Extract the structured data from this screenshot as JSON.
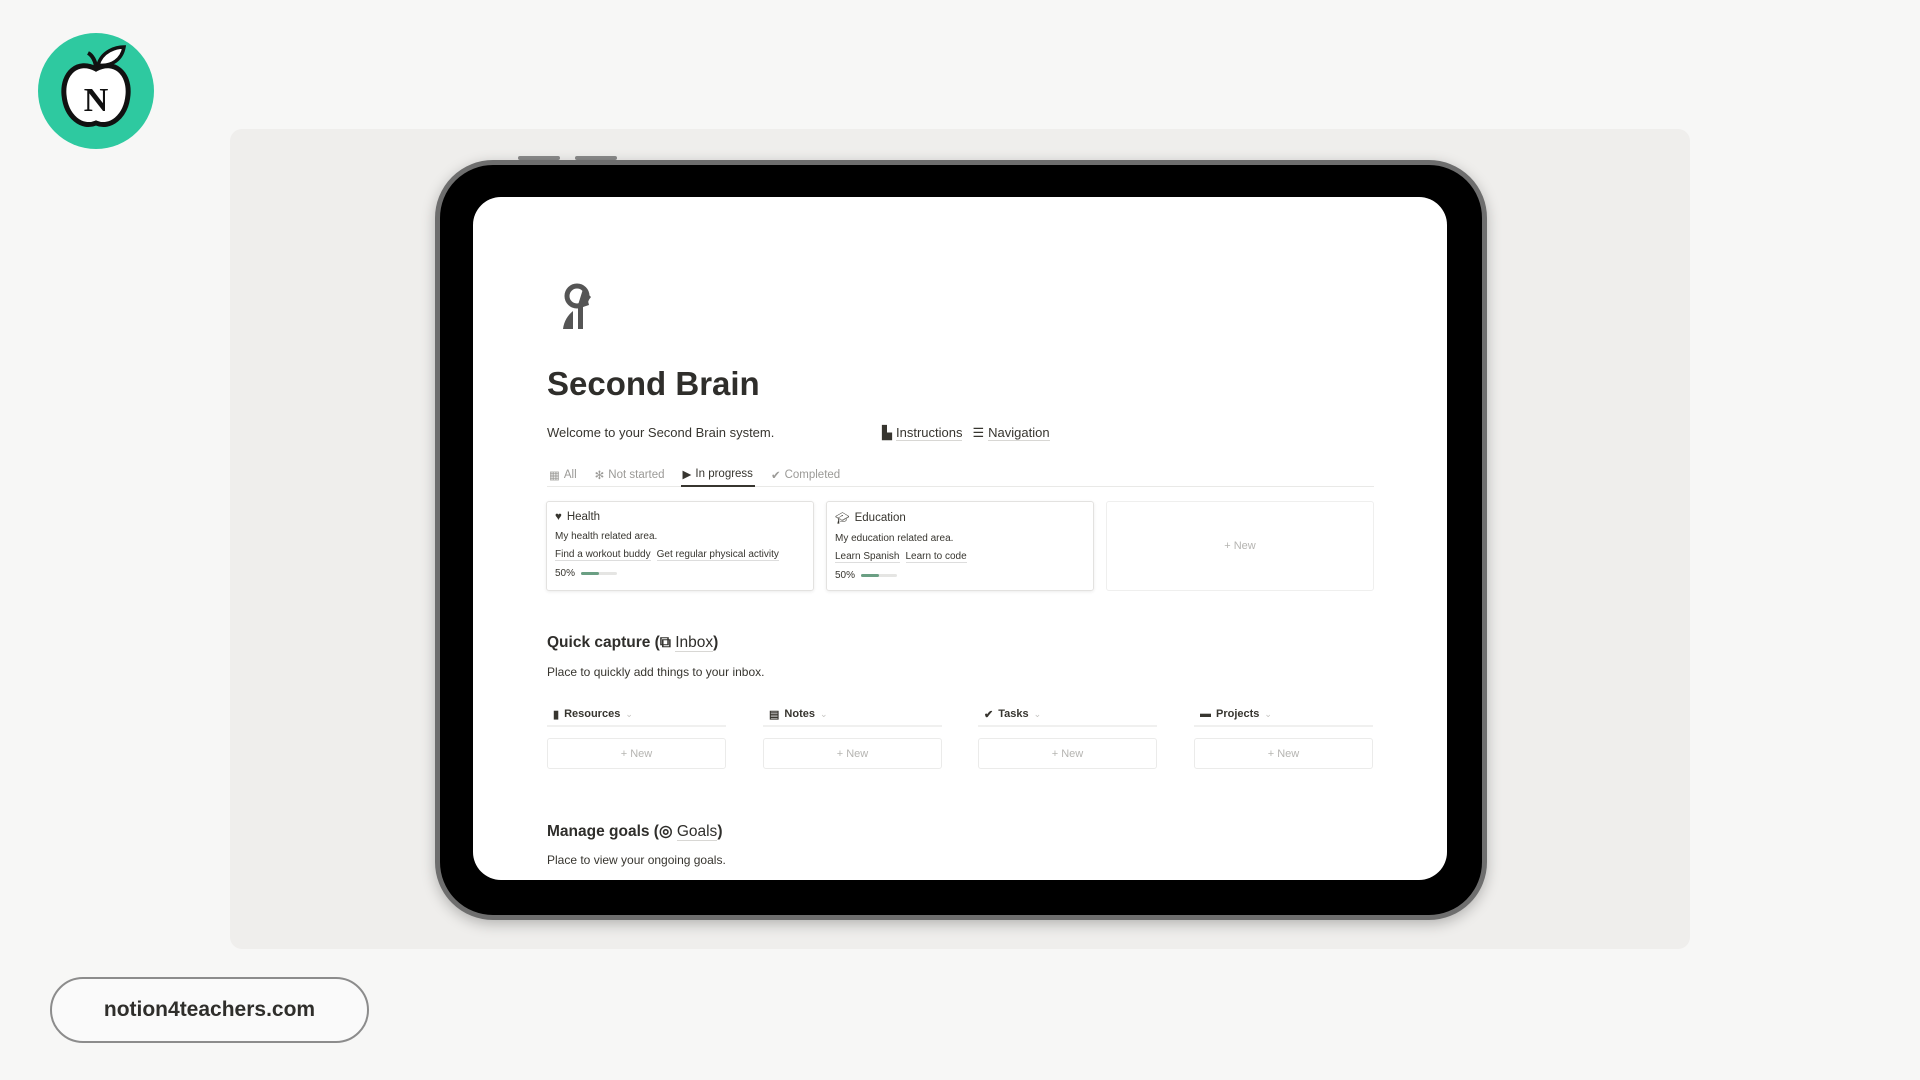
{
  "brand": {
    "logo_letter": "N",
    "url": "notion4teachers.com",
    "accent": "#2ec9a0"
  },
  "page": {
    "icon": "head-brain-icon",
    "title": "Second Brain",
    "welcome": "Welcome to your Second Brain system.",
    "links": [
      {
        "label": "Instructions",
        "icon": "book-link-icon"
      },
      {
        "label": "Navigation",
        "icon": "list-link-icon"
      }
    ]
  },
  "tabs": [
    {
      "label": "All",
      "icon": "grid-icon"
    },
    {
      "label": "Not started",
      "icon": "asterisk-icon"
    },
    {
      "label": "In progress",
      "icon": "play-icon",
      "active": true
    },
    {
      "label": "Completed",
      "icon": "check-circle-icon"
    }
  ],
  "areas": [
    {
      "name": "Health",
      "icon": "heart-icon",
      "desc": "My health related area.",
      "goals": [
        "Find a workout buddy",
        "Get regular physical activity"
      ],
      "progress_label": "50%",
      "progress": 0.5
    },
    {
      "name": "Education",
      "icon": "graduation-cap-icon",
      "desc": "My education related area.",
      "goals": [
        "Learn Spanish",
        "Learn to code"
      ],
      "progress_label": "50%",
      "progress": 0.5
    }
  ],
  "new_label": "+ New",
  "quick": {
    "title_pre": "Quick capture (",
    "link": "Inbox",
    "title_post": ")",
    "desc": "Place to quickly add things to your inbox.",
    "columns": [
      {
        "label": "Resources",
        "icon": "bookmark-icon"
      },
      {
        "label": "Notes",
        "icon": "note-icon"
      },
      {
        "label": "Tasks",
        "icon": "check-circle-icon"
      },
      {
        "label": "Projects",
        "icon": "folder-icon"
      }
    ]
  },
  "goals": {
    "title_pre": "Manage goals (",
    "link": "Goals",
    "title_post": ")",
    "desc": "Place to view your ongoing goals."
  },
  "progress_color": "#6a9f83"
}
